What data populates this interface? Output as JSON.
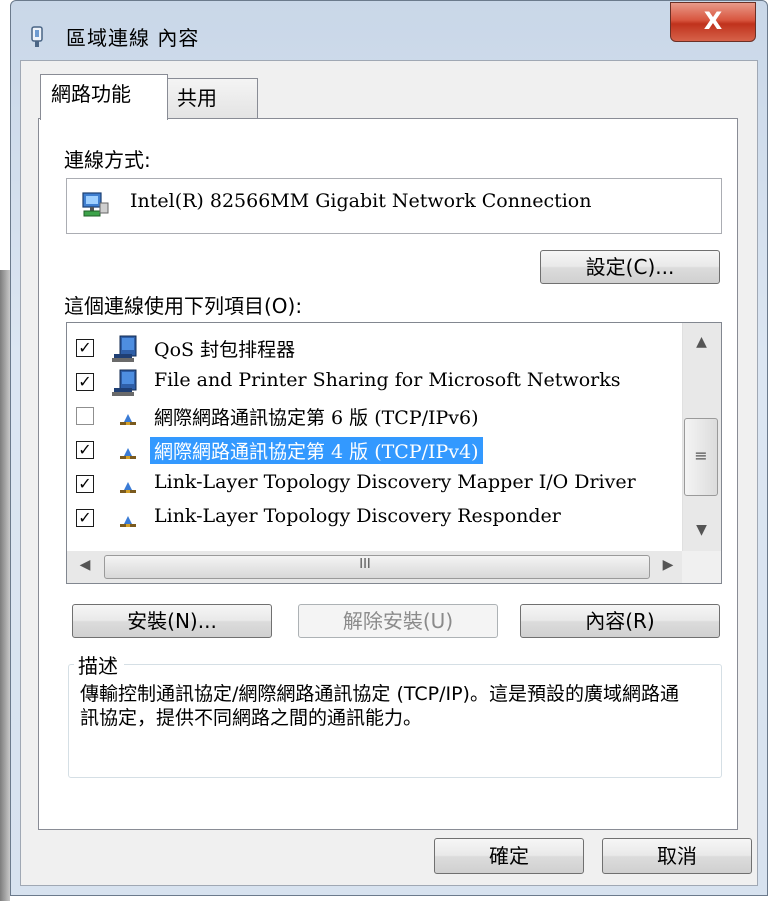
{
  "window": {
    "title": "區域連線 內容",
    "close_label": "X"
  },
  "tabs": [
    {
      "label": "網路功能"
    },
    {
      "label": "共用"
    }
  ],
  "connect_using": {
    "label": "連線方式:",
    "adapter": "Intel(R) 82566MM Gigabit Network Connection",
    "configure_button": "設定(C)..."
  },
  "items_label": "這個連線使用下列項目(O):",
  "items": [
    {
      "label": "QoS 封包排程器",
      "checked": true,
      "icon": "computer-icon",
      "selected": false
    },
    {
      "label": "File and Printer Sharing for Microsoft Networks",
      "checked": true,
      "icon": "computer-icon",
      "selected": false
    },
    {
      "label": "網際網路通訊協定第 6 版 (TCP/IPv6)",
      "checked": false,
      "icon": "protocol-icon",
      "selected": false
    },
    {
      "label": "網際網路通訊協定第 4 版 (TCP/IPv4)",
      "checked": true,
      "icon": "protocol-icon",
      "selected": true
    },
    {
      "label": "Link-Layer Topology Discovery Mapper I/O Driver",
      "checked": true,
      "icon": "protocol-icon",
      "selected": false
    },
    {
      "label": "Link-Layer Topology Discovery Responder",
      "checked": true,
      "icon": "protocol-icon",
      "selected": false
    }
  ],
  "scrollbar": {
    "grip": "≡",
    "h_grip": "III"
  },
  "buttons": {
    "install": "安裝(N)...",
    "uninstall": "解除安裝(U)",
    "properties": "內容(R)"
  },
  "description": {
    "title": "描述",
    "text": "傳輸控制通訊協定/網際網路通訊協定 (TCP/IP)。這是預設的廣域網路通訊協定，提供不同網路之間的通訊能力。"
  },
  "footer": {
    "ok": "確定",
    "cancel": "取消"
  },
  "colors": {
    "selection": "#3399ff",
    "close": "#c0321c",
    "frame": "#dce6f2"
  }
}
